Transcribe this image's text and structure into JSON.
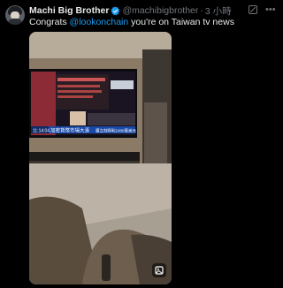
{
  "tweet": {
    "author_name": "Machi Big Brother",
    "handle": "@machibigbrother",
    "separator": "·",
    "time": "3 小時",
    "text_prefix": "Congrats ",
    "mention": "@lookonchain",
    "text_suffix": " you're on Taiwan tv news"
  },
  "tv": {
    "ticker_time": "11:14:04",
    "ticker_text": "加密貨幣市場大漲",
    "ticker_right": "獲立刻得利1000萬美元"
  },
  "colors": {
    "background": "#000000",
    "text": "#e7e9ea",
    "muted": "#71767b",
    "link": "#1d9bf0",
    "verified": "#1d9bf0"
  },
  "icons": [
    "verified-badge-icon",
    "grok-icon",
    "more-icon",
    "media-expand-icon"
  ]
}
